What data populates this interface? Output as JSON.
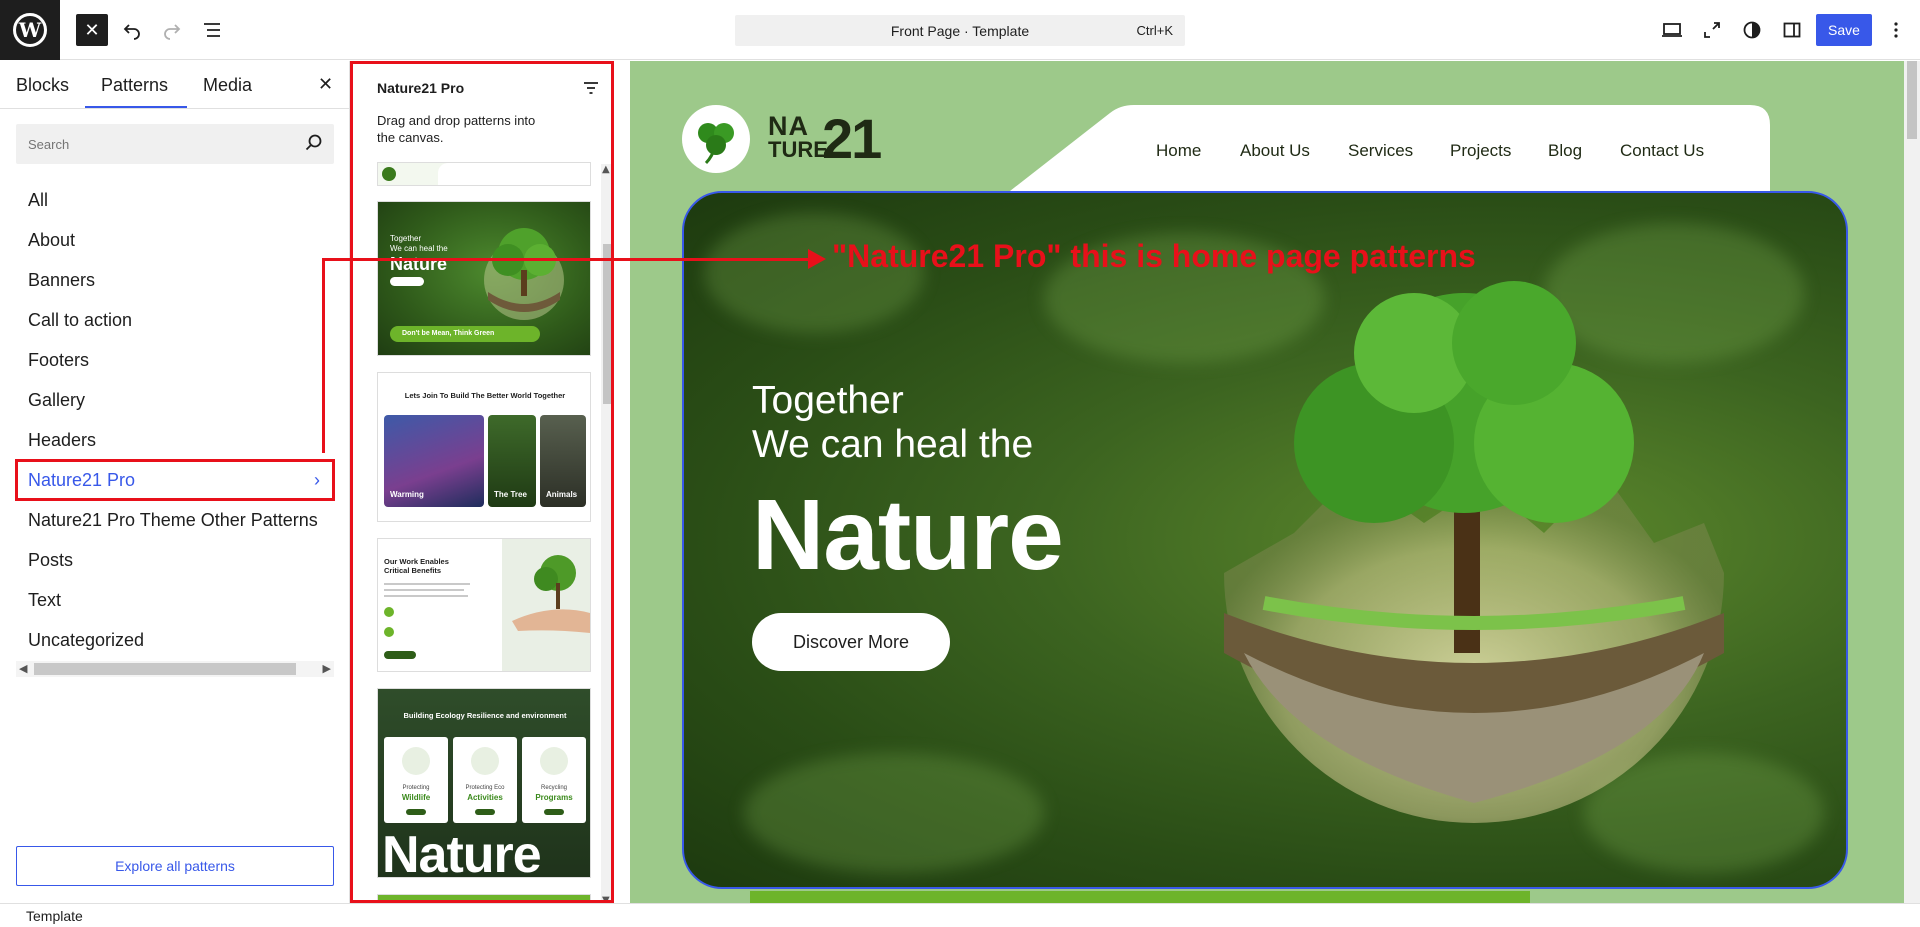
{
  "toolbar": {
    "document_title": "Front Page · Template",
    "shortcut": "Ctrl+K",
    "save_label": "Save"
  },
  "inserter": {
    "tabs": [
      {
        "label": "Blocks"
      },
      {
        "label": "Patterns"
      },
      {
        "label": "Media"
      }
    ],
    "active_tab": "Patterns",
    "search_placeholder": "Search",
    "categories": [
      {
        "label": "All"
      },
      {
        "label": "About"
      },
      {
        "label": "Banners"
      },
      {
        "label": "Call to action"
      },
      {
        "label": "Footers"
      },
      {
        "label": "Gallery"
      },
      {
        "label": "Headers"
      },
      {
        "label": "Nature21 Pro"
      },
      {
        "label": "Nature21 Pro Theme Other Patterns"
      },
      {
        "label": "Posts"
      },
      {
        "label": "Text"
      },
      {
        "label": "Uncategorized"
      }
    ],
    "selected_category": "Nature21 Pro",
    "explore_label": "Explore all patterns"
  },
  "patterns_panel": {
    "title": "Nature21 Pro",
    "description": "Drag and drop patterns into the canvas.",
    "cards": {
      "hero_line1": "Together",
      "hero_line2": "We can heal the",
      "hero_big": "Nature",
      "hero_bar": "Don't be Mean, Think Green",
      "join_heading": "Lets Join To Build The Better World Together",
      "join_items": [
        "Warming",
        "The Tree",
        "Animals"
      ],
      "benefits_heading": "Our Work Enables Critical Benefits",
      "ecology_heading": "Building Ecology Resilience and environment",
      "ecology_items": [
        {
          "sub": "Protecting",
          "title": "Wildlife"
        },
        {
          "sub": "Protecting Eco",
          "title": "Activities"
        },
        {
          "sub": "Recycling",
          "title": "Programs"
        }
      ],
      "ecology_big": "Nature"
    }
  },
  "canvas": {
    "logo_na": "NA",
    "logo_ture": "TURE",
    "logo_21": "21",
    "nav": [
      "Home",
      "About Us",
      "Services",
      "Projects",
      "Blog",
      "Contact Us"
    ],
    "hero_line1": "Together",
    "hero_line2": "We can heal the",
    "hero_big": "Nature",
    "hero_button": "Discover More",
    "annotation": "\"Nature21 Pro\" this is home page patterns"
  },
  "footer": {
    "breadcrumb": "Template"
  },
  "colors": {
    "accent": "#3858e9",
    "annotation": "#e8101a",
    "brand_green": "#6db42a",
    "canvas_bg": "#9dc98a"
  }
}
